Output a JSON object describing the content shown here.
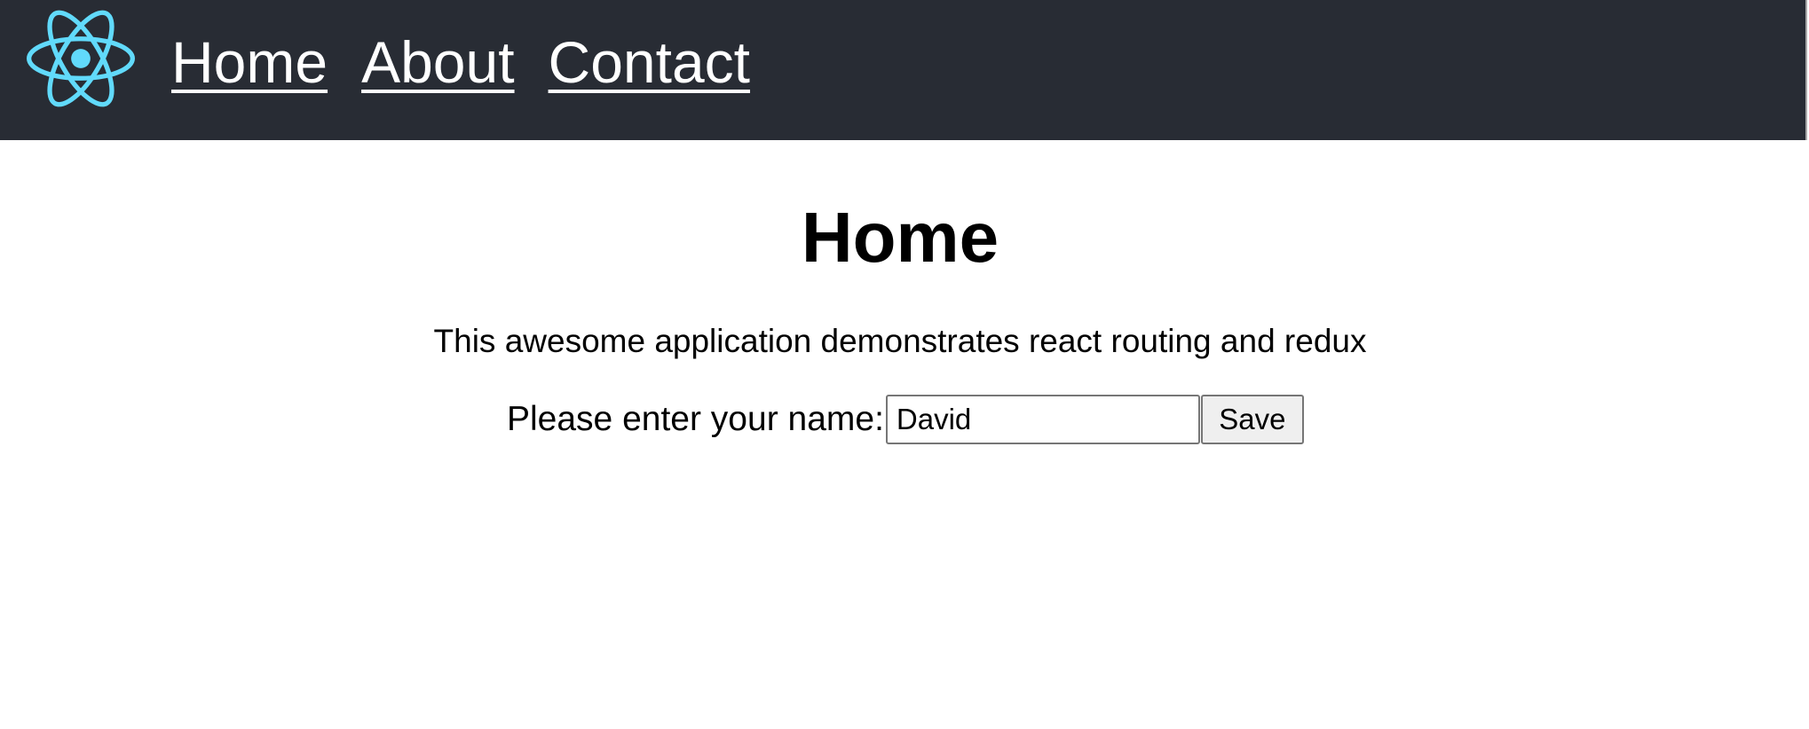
{
  "header": {
    "logo_icon": "react-logo-icon",
    "logo_color": "#61dafb",
    "background": "#282c34",
    "nav": [
      {
        "label": "Home"
      },
      {
        "label": "About"
      },
      {
        "label": "Contact"
      }
    ]
  },
  "main": {
    "title": "Home",
    "intro": "This awesome application demonstrates react routing and redux",
    "form": {
      "label": "Please enter your name:",
      "name_value": "David",
      "save_label": "Save"
    }
  }
}
